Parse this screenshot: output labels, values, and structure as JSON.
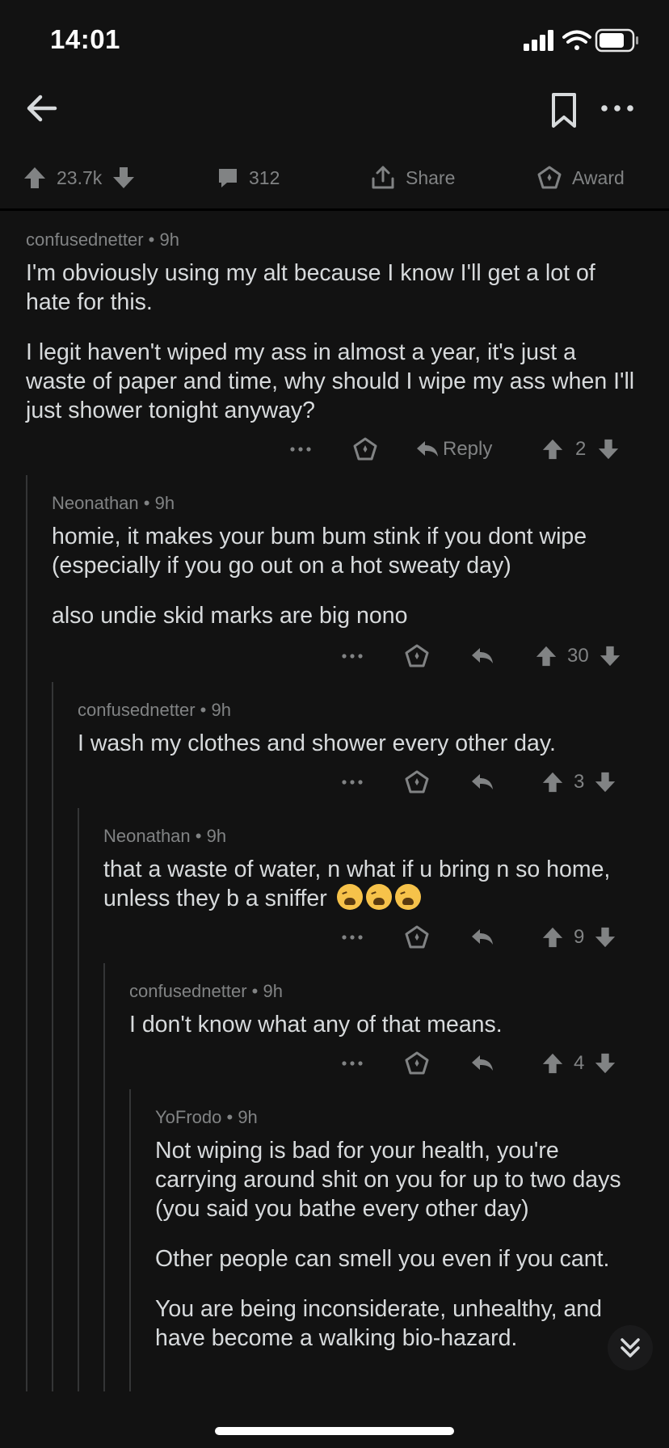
{
  "status": {
    "time": "14:01"
  },
  "post": {
    "upvotes": "23.7k",
    "comments": "312",
    "share_label": "Share",
    "award_label": "Award"
  },
  "comments": [
    {
      "author": "confusednetter",
      "time": "9h",
      "body": [
        "I'm obviously using my alt because I know I'll get a lot of hate for this.",
        "I legit haven't wiped my ass in almost a year, it's just a waste of paper and time, why should I wipe my ass when I'll just shower tonight anyway?"
      ],
      "reply_label": "Reply",
      "score": "2"
    },
    {
      "author": "Neonathan",
      "time": "9h",
      "body": [
        "homie, it makes your bum bum stink if you dont wipe (especially if you go out on a hot sweaty day)",
        "also undie skid marks are big nono"
      ],
      "score": "30"
    },
    {
      "author": "confusednetter",
      "time": "9h",
      "body": [
        "I wash my clothes and shower every other day."
      ],
      "score": "3"
    },
    {
      "author": "Neonathan",
      "time": "9h",
      "body": [
        "that a waste of water, n what if u bring n so home, unless they b a sniffer"
      ],
      "emoji": "weary-face",
      "score": "9"
    },
    {
      "author": "confusednetter",
      "time": "9h",
      "body": [
        "I don't know what any of that means."
      ],
      "score": "4"
    },
    {
      "author": "YoFrodo",
      "time": "9h",
      "body": [
        "Not wiping is bad for your health, you're carrying around shit on you for up to two days (you said you bathe every other day)",
        "Other people can smell you even if you cant.",
        "You are being inconsiderate, unhealthy, and have become a walking bio-hazard."
      ]
    }
  ],
  "colors": {
    "background": "#121212",
    "text": "#d7dadc",
    "muted": "#818384"
  }
}
